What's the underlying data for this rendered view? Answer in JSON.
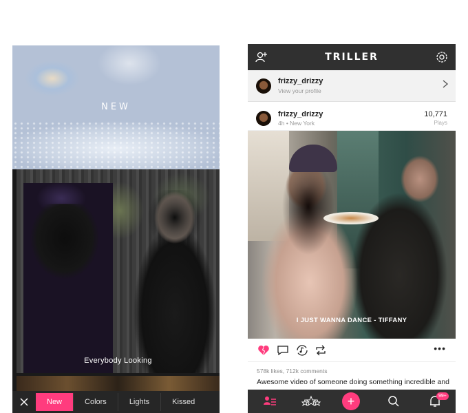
{
  "left_screen": {
    "banner_label": "NEW",
    "video_caption": "Everybody Looking",
    "close_icon": "close-icon",
    "filters": [
      "New",
      "Colors",
      "Lights",
      "Kissed"
    ],
    "active_filter": "New",
    "accent_color": "#ff3c7e"
  },
  "right_screen": {
    "header": {
      "logo": "TRILLER",
      "add_user_icon": "add-user-icon",
      "settings_icon": "gear-icon"
    },
    "profile_row": {
      "username": "frizzy_drizzy",
      "subtitle": "View your profile"
    },
    "post": {
      "username": "frizzy_drizzy",
      "meta": "4h • New York",
      "plays_count": "10,771",
      "plays_label": "Plays",
      "caption": "I JUST WANNA DANCE - ",
      "caption_artist": "TIFFANY",
      "stats": "578k likes, 712k comments",
      "description": "Awesome video of someone doing something incredible and the"
    },
    "nav": {
      "badge": "99+"
    },
    "accent_color": "#ff3c7e"
  }
}
